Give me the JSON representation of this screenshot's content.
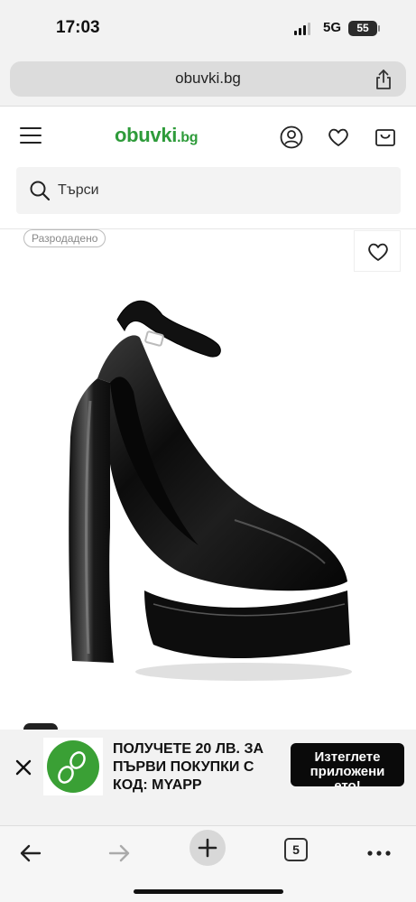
{
  "status_bar": {
    "time": "17:03",
    "network": "5G",
    "battery": "55"
  },
  "browser": {
    "url": "obuvki.bg",
    "tab_count": "5"
  },
  "site": {
    "logo_main": "obuvki",
    "logo_suffix": ".bg",
    "brand_color": "#2e9b3a"
  },
  "search": {
    "placeholder": "Търси"
  },
  "product": {
    "badge": "Разродадено"
  },
  "promo": {
    "text": "ПОЛУЧЕТЕ 20 ЛВ. ЗА ПЪРВИ ПОКУПКИ С КОД: MYAPP",
    "button_label": "Изтеглете приложени ето!"
  },
  "icons": {
    "menu": "hamburger-icon",
    "account": "user-icon",
    "wishlist": "heart-icon",
    "cart": "shopping-bag-icon",
    "share": "share-icon",
    "close": "close-icon",
    "back": "back-arrow-icon",
    "forward": "forward-arrow-icon",
    "new_tab": "plus-icon",
    "more": "more-icon"
  }
}
